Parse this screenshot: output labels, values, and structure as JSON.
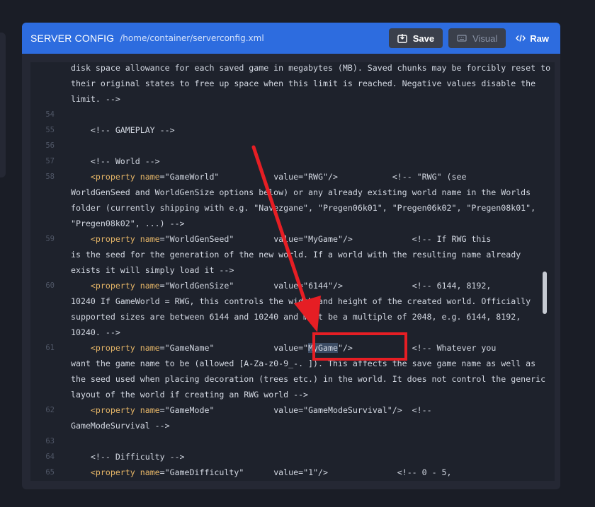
{
  "header": {
    "title": "SERVER CONFIG",
    "path": "/home/container/serverconfig.xml",
    "save_label": "Save",
    "visual_label": "Visual",
    "raw_label": "Raw"
  },
  "lines": [
    {
      "n": "",
      "t": "disk space allowance for each saved game in megabytes (MB). Saved chunks may be forcibly reset to"
    },
    {
      "n": "",
      "t": "their original states to free up space when this limit is reached. Negative values disable the"
    },
    {
      "n": "",
      "t": "limit. -->"
    },
    {
      "n": "54",
      "t": ""
    },
    {
      "n": "55",
      "t": "    <!-- GAMEPLAY -->"
    },
    {
      "n": "56",
      "t": ""
    },
    {
      "n": "57",
      "t": "    <!-- World -->"
    },
    {
      "n": "58",
      "prop": "GameWorld",
      "value": "RWG",
      "comment": "           <!-- \"RWG\" (see"
    },
    {
      "n": "",
      "t": "WorldGenSeed and WorldGenSize options below) or any already existing world name in the Worlds"
    },
    {
      "n": "",
      "t": "folder (currently shipping with e.g. \"Navezgane\", \"Pregen06k01\", \"Pregen06k02\", \"Pregen08k01\","
    },
    {
      "n": "",
      "t": "\"Pregen08k02\", ...) -->"
    },
    {
      "n": "59",
      "prop": "WorldGenSeed",
      "value": "MyGame",
      "comment": "            <!-- If RWG this"
    },
    {
      "n": "",
      "t": "is the seed for the generation of the new world. If a world with the resulting name already"
    },
    {
      "n": "",
      "t": "exists it will simply load it -->"
    },
    {
      "n": "60",
      "prop": "WorldGenSize",
      "value": "6144",
      "comment": "              <!-- 6144, 8192,"
    },
    {
      "n": "",
      "t": "10240 If GameWorld = RWG, this controls the width and height of the created world. Officially"
    },
    {
      "n": "",
      "t": "supported sizes are between 6144 and 10240 and must be a multiple of 2048, e.g. 6144, 8192,"
    },
    {
      "n": "",
      "t": "10240. -->"
    },
    {
      "n": "61",
      "prop": "GameName",
      "value": "MyGame",
      "comment": "            <!-- Whatever you",
      "selected": true
    },
    {
      "n": "",
      "t": "want the game name to be (allowed [A-Za-z0-9_-. ]). This affects the save game name as well as"
    },
    {
      "n": "",
      "t": "the seed used when placing decoration (trees etc.) in the world. It does not control the generic"
    },
    {
      "n": "",
      "t": "layout of the world if creating an RWG world -->"
    },
    {
      "n": "62",
      "prop": "GameMode",
      "value": "GameModeSurvival",
      "comment": "  <!--"
    },
    {
      "n": "",
      "t": "GameModeSurvival -->"
    },
    {
      "n": "63",
      "t": ""
    },
    {
      "n": "64",
      "t": "    <!-- Difficulty -->"
    },
    {
      "n": "65",
      "prop": "GameDifficulty",
      "value": "1",
      "comment": "              <!-- 0 - 5,"
    }
  ]
}
